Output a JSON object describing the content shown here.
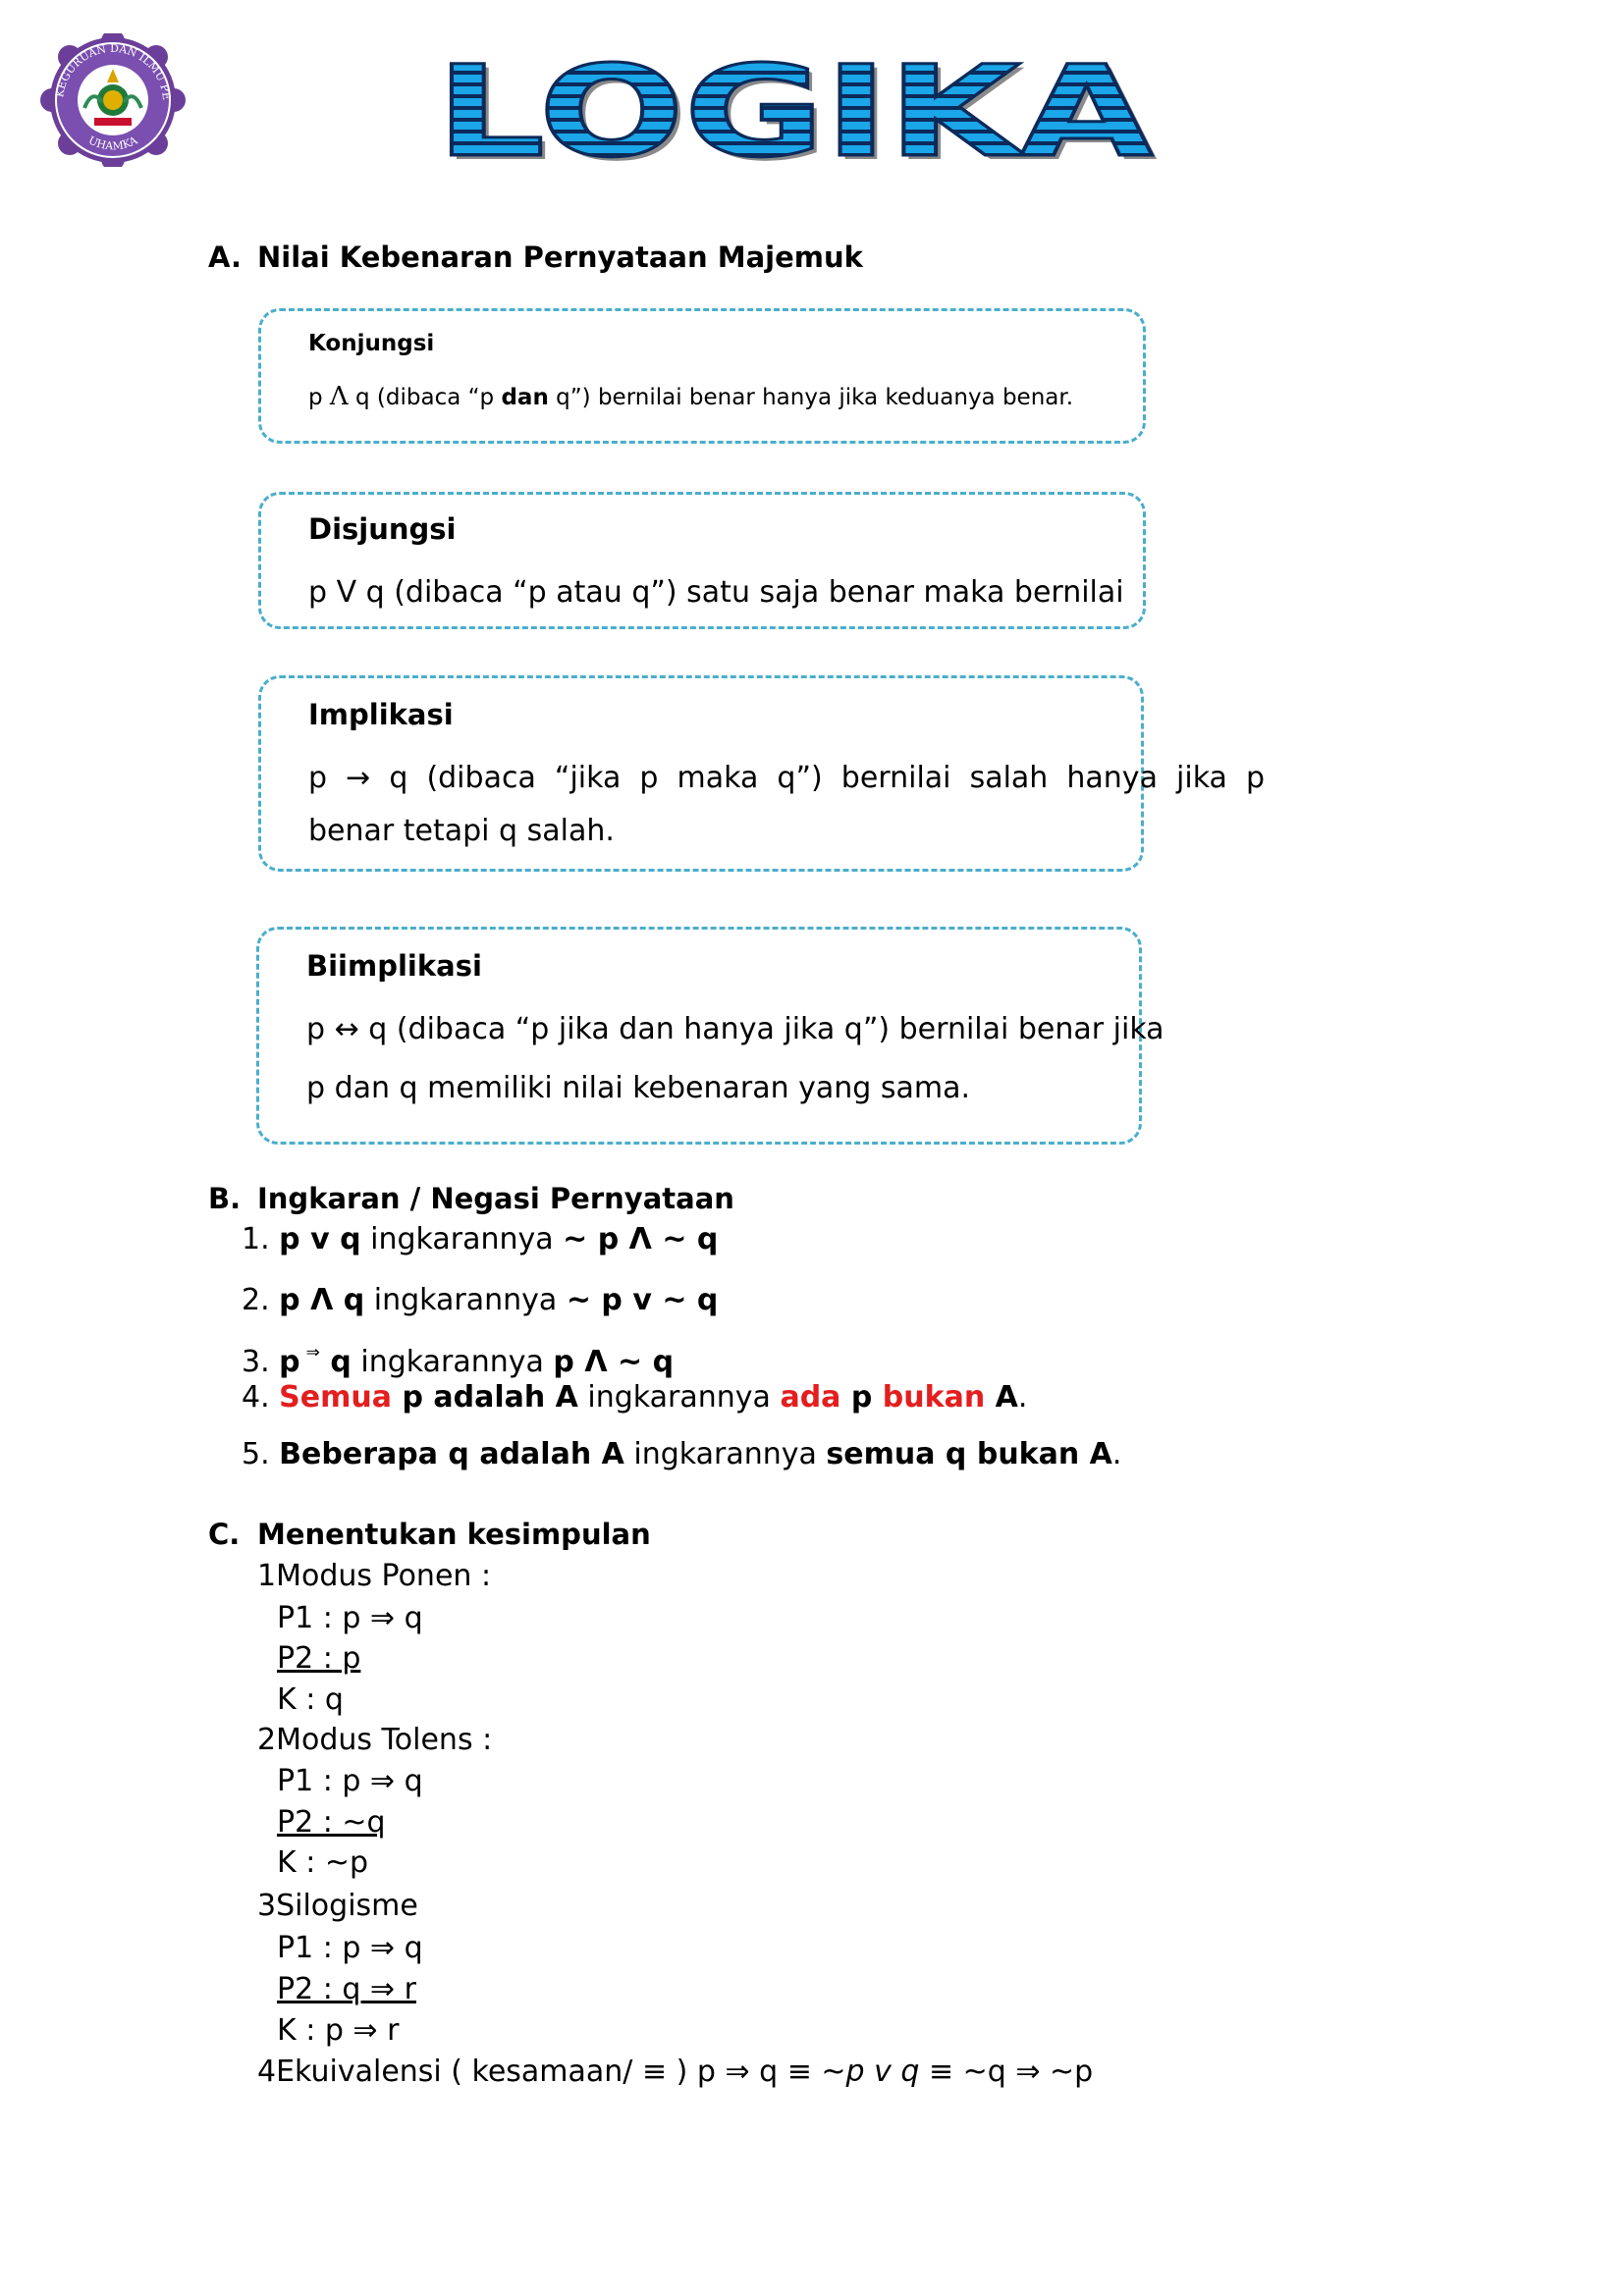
{
  "header": {
    "logo_text_top": "FAKULTAS KEGURUAN DAN ILMU PENDIDIKAN",
    "logo_text_bottom": "UHAMKA",
    "title": "LOGIKA"
  },
  "section_a": {
    "letter": "A.",
    "title": "Nilai Kebenaran Pernyataan Majemuk",
    "boxes": [
      {
        "heading": "Konjungsi",
        "line1_pre": "p ",
        "line1_sym": "Λ",
        "line1_mid": " q (dibaca “p ",
        "line1_bold": "dan",
        "line1_post": " q”) bernilai benar hanya jika keduanya benar."
      },
      {
        "heading": "Disjungsi",
        "line1": "p V q (dibaca “p atau q”) satu saja benar maka bernilai"
      },
      {
        "heading": "Implikasi",
        "line1": "p  →  q  (dibaca  “jika  p  maka  q”)  bernilai  salah  hanya  jika  p",
        "line2": "benar tetapi q salah."
      },
      {
        "heading": "Biimplikasi",
        "line1": "p ↔ q (dibaca “p jika dan hanya jika q”) bernilai benar jika",
        "line2": "p dan q memiliki nilai kebenaran yang sama."
      }
    ]
  },
  "section_b": {
    "letter": "B.",
    "title": "Ingkaran / Negasi Pernyataan",
    "items": [
      {
        "num": "1.",
        "a": "p v q",
        "mid": " ingkarannya ",
        "b": "~ p Λ ~ q"
      },
      {
        "num": "2.",
        "a": "p Λ q",
        "mid": " ingkarannya ",
        "b": "~ p v ~ q"
      },
      {
        "num": "3.",
        "a": "p",
        "sym": "⇒",
        "a2": " q",
        "mid": " ingkarannya ",
        "b": "p Λ ~ q"
      },
      {
        "num": "4.",
        "r1": "Semua",
        "a": " p adalah A",
        "mid": " ingkarannya ",
        "r2": "ada",
        "a2": " p ",
        "r3": "bukan",
        "b": " A",
        "end": "."
      },
      {
        "num": "5.",
        "a": "Beberapa q adalah A",
        "mid": " ingkarannya ",
        "b": "semua q bukan A",
        "end": "."
      }
    ]
  },
  "section_c": {
    "letter": "C.",
    "title": "Menentukan kesimpulan",
    "groups": [
      {
        "num": "1",
        "name": "Modus Ponen :",
        "p1": "P1 : p ⇒ q",
        "p2": "P2 : p",
        "k": "K : q"
      },
      {
        "num": "2",
        "name": "Modus Tolens :",
        "p1": "P1 : p ⇒ q",
        "p2": "P2 : ~q",
        "k": "K : ~p"
      },
      {
        "num": "3",
        "name": "Silogisme",
        "p1": "P1 : p ⇒ q",
        "p2": "P2 : q ⇒ r",
        "k": "K : p ⇒ r"
      }
    ],
    "equiv": {
      "num": "4",
      "pre": "Ekuivalensi ( kesamaan/ ≡ ) p ⇒ q ≡ ~",
      "ital": "p v q",
      "post": " ≡ ~q ⇒ ~p"
    }
  }
}
